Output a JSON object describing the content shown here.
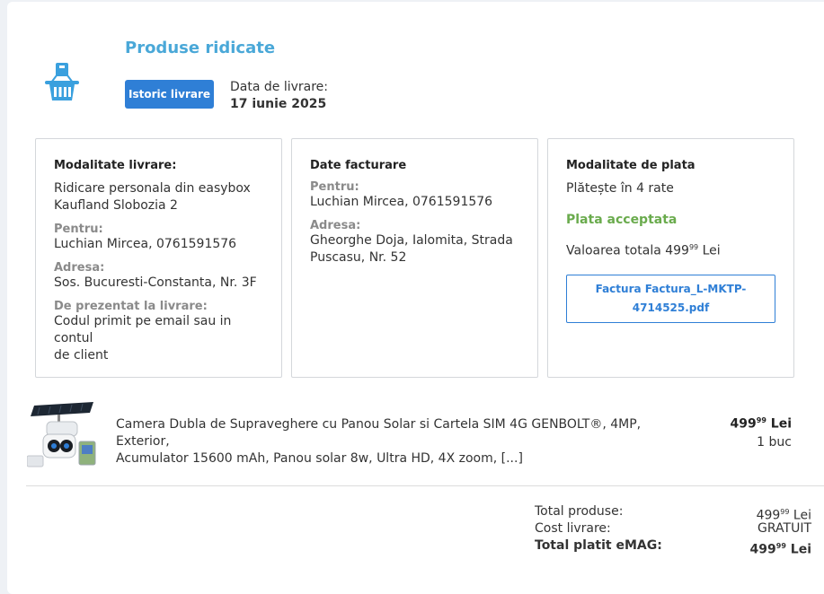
{
  "order": {
    "status_title": "Produse ridicate",
    "history_button": "Istoric livrare",
    "delivery_date_label": "Data de livrare:",
    "delivery_date_value": "17 iunie 2025"
  },
  "delivery": {
    "title": "Modalitate livrare:",
    "method_line1": "Ridicare personala din easybox",
    "method_line2": "Kaufland Slobozia 2",
    "for_label": "Pentru:",
    "for_value": "Luchian Mircea, 0761591576",
    "address_label": "Adresa:",
    "address_value": "Sos. Bucuresti-Constanta, Nr. 3F",
    "present_label": "De prezentat la livrare:",
    "present_value_line1": "Codul primit pe email sau in contul",
    "present_value_line2": "de client"
  },
  "billing": {
    "title": "Date facturare",
    "for_label": "Pentru:",
    "for_value": "Luchian Mircea, 0761591576",
    "address_label": "Adresa:",
    "address_line1": "Gheorghe Doja, Ialomita, Strada",
    "address_line2": "Puscasu, Nr. 52"
  },
  "payment": {
    "title": "Modalitate de plata",
    "method": "Plătește în 4 rate",
    "status": "Plata acceptata",
    "total_prefix": "Valoarea totala 499",
    "total_cents": "99",
    "total_currency": " Lei",
    "invoice_line1": "Factura Factura_L-MKTP-",
    "invoice_line2": "4714525.pdf",
    "status_color": "#6aab4d"
  },
  "product": {
    "name_line1": "Camera Dubla de Supraveghere cu Panou Solar si Cartela SIM 4G GENBOLT®, 4MP, Exterior,",
    "name_line2": "Acumulator 15600 mAh, Panou solar 8w, Ultra HD, 4X zoom, [...]",
    "price_int": "499",
    "price_cents": "99",
    "price_currency": " Lei",
    "quantity": "1 buc"
  },
  "summary": {
    "products_label": "Total produse:",
    "products_int": "499",
    "products_cents": "99",
    "products_currency": " Lei",
    "shipping_label": "Cost livrare:",
    "shipping_value": "GRATUIT",
    "paid_label": "Total platit eMAG:",
    "paid_int": "499",
    "paid_cents": "99",
    "paid_currency": " Lei"
  },
  "colors": {
    "accent": "#2f7fd6",
    "title": "#4aa8d8",
    "icon": "#3aa0de"
  }
}
